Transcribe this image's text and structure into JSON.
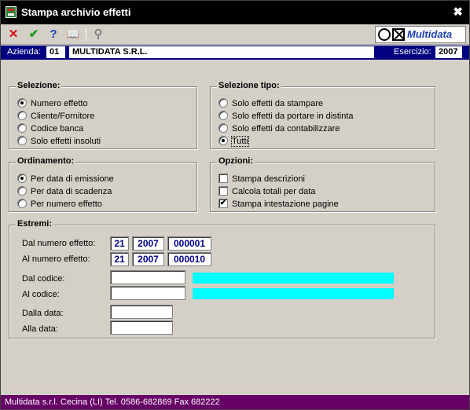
{
  "window": {
    "title": "Stampa archivio effetti",
    "close_glyph": "✖"
  },
  "toolbar": {
    "cancel_glyph": "✕",
    "confirm_glyph": "✔",
    "help_glyph": "?",
    "book_glyph": "📖",
    "find_glyph": "⚲",
    "logo_text": "Multidata"
  },
  "info": {
    "azienda_label": "Azienda:",
    "azienda_code": "01",
    "azienda_name": "MULTIDATA S.R.L.",
    "esercizio_label": "Esercizio:",
    "esercizio_value": "2007"
  },
  "selezione": {
    "title": "Selezione:",
    "options": [
      {
        "label": "Numero effetto",
        "selected": true
      },
      {
        "label": "Cliente/Fornitore",
        "selected": false
      },
      {
        "label": "Codice banca",
        "selected": false
      },
      {
        "label": "Solo effetti insoluti",
        "selected": false
      }
    ]
  },
  "selezione_tipo": {
    "title": "Selezione tipo:",
    "options": [
      {
        "label": "Solo effetti da stampare",
        "selected": false
      },
      {
        "label": "Solo effetti da portare in distinta",
        "selected": false
      },
      {
        "label": "Solo effetti da contabilizzare",
        "selected": false
      },
      {
        "label": "Tutti",
        "selected": true
      }
    ]
  },
  "ordinamento": {
    "title": "Ordinamento:",
    "options": [
      {
        "label": "Per data di emissione",
        "selected": true
      },
      {
        "label": "Per data di scadenza",
        "selected": false
      },
      {
        "label": "Per numero effetto",
        "selected": false
      }
    ]
  },
  "opzioni": {
    "title": "Opzioni:",
    "options": [
      {
        "label": "Stampa descrizioni",
        "checked": false
      },
      {
        "label": "Calcola totali per data",
        "checked": false
      },
      {
        "label": "Stampa intestazione pagine",
        "checked": true
      }
    ],
    "check_glyph": "✔"
  },
  "estremi": {
    "title": "Estremi:",
    "dal_numero_label": "Dal numero effetto:",
    "dal_numero": {
      "serie": "21",
      "anno": "2007",
      "numero": "000001"
    },
    "al_numero_label": "Al numero effetto:",
    "al_numero": {
      "serie": "21",
      "anno": "2007",
      "numero": "000010"
    },
    "dal_codice_label": "Dal codice:",
    "dal_codice_value": "",
    "al_codice_label": "Al codice:",
    "al_codice_value": "",
    "dalla_data_label": "Dalla data:",
    "dalla_data_value": "",
    "alla_data_label": "Alla data:",
    "alla_data_value": ""
  },
  "status": {
    "text": "Multidata s.r.l. Cecina (LI) Tel. 0586-682869  Fax 682222"
  },
  "colors": {
    "title_bg": "#000000",
    "info_bg": "#000080",
    "status_bg": "#660066",
    "highlight": "#00ffff"
  }
}
